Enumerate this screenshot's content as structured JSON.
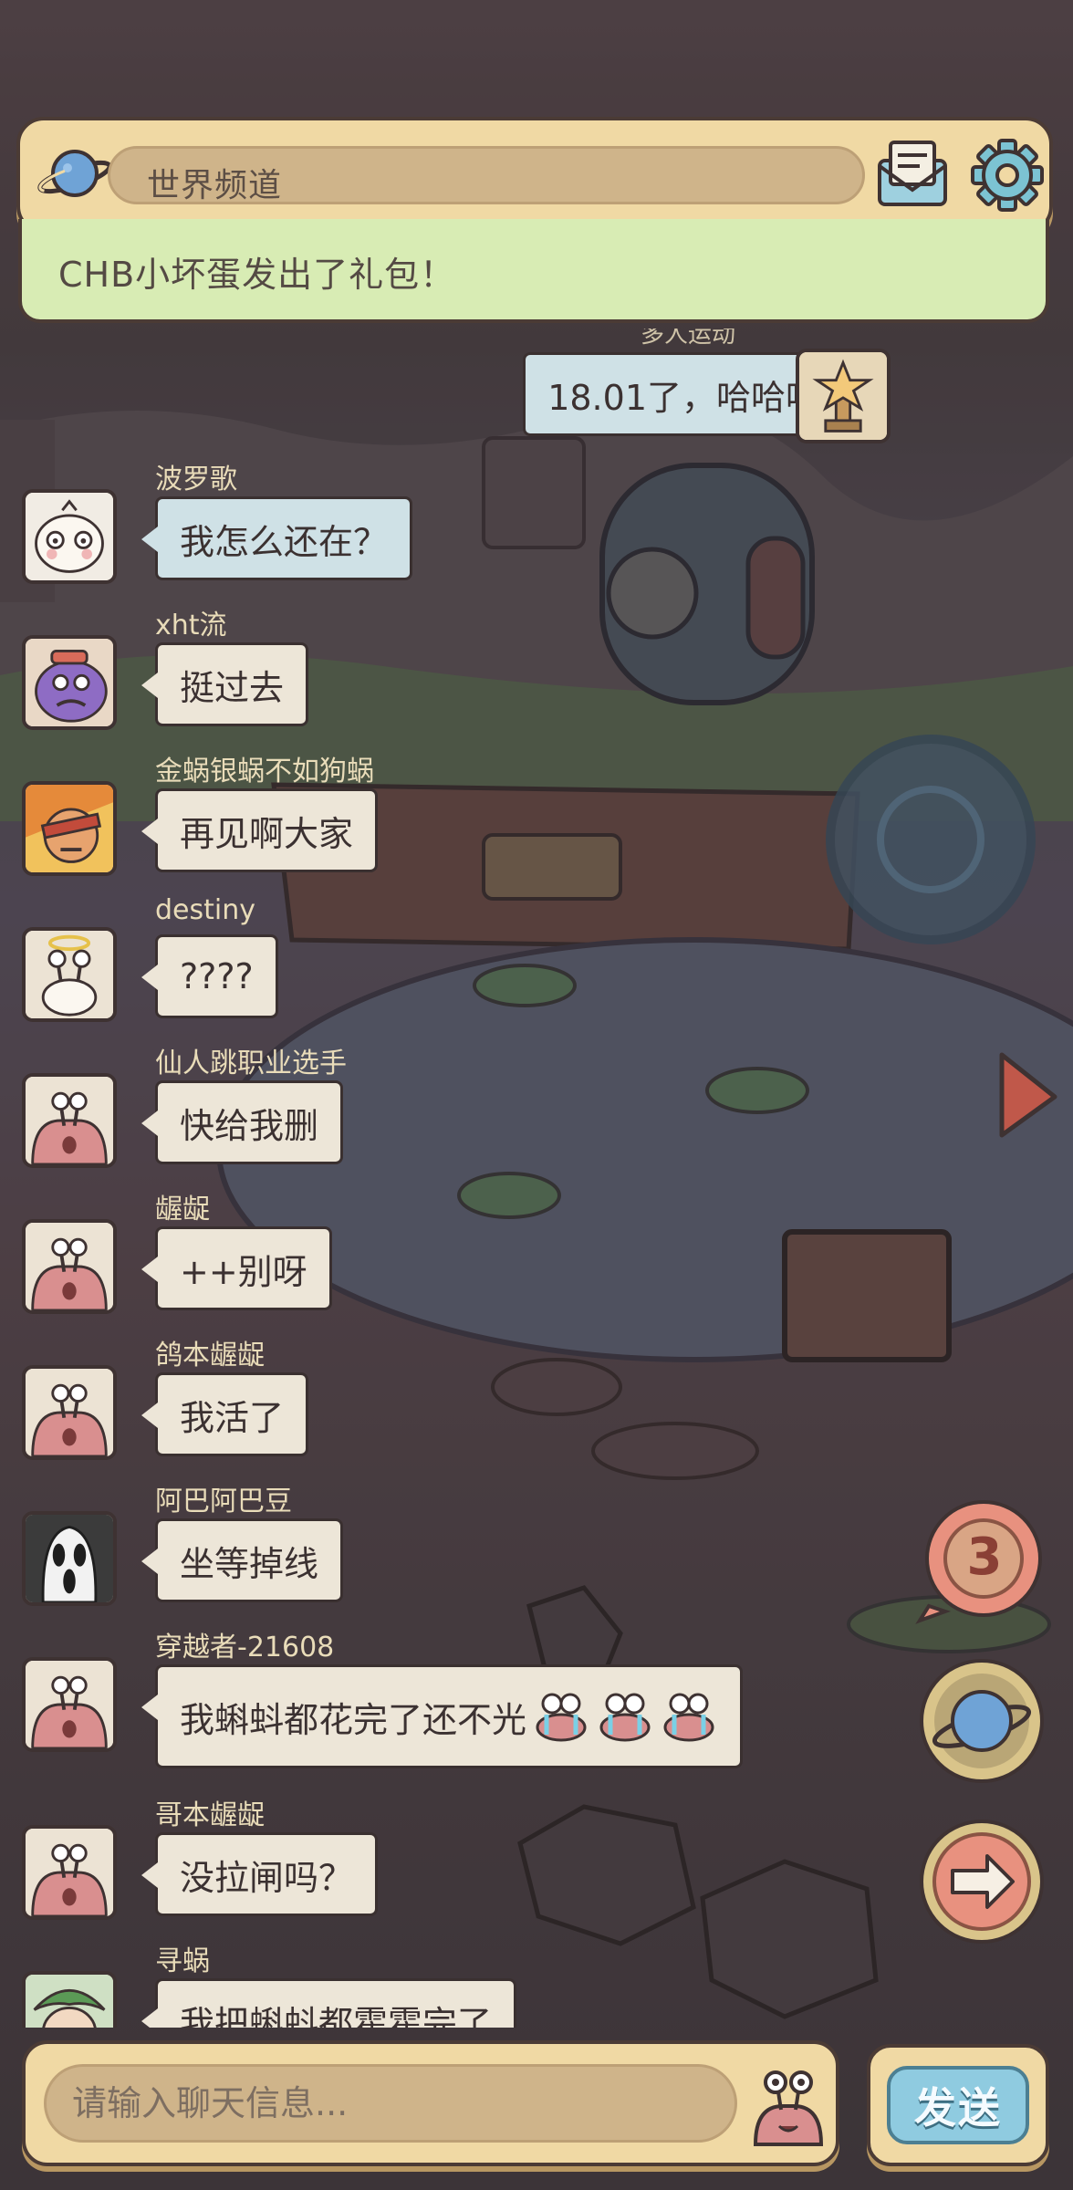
{
  "header": {
    "title": "世界频道",
    "gift_notice": "CHB小坏蛋发出了礼包！"
  },
  "self_message": {
    "name": "多人运动",
    "text": "18.01了，哈哈哈"
  },
  "messages": [
    {
      "name": "波罗歌",
      "text": "我怎么还在？"
    },
    {
      "name": "xht流",
      "text": "挺过去"
    },
    {
      "name": "金蜗银蜗不如狗蜗",
      "text": "再见啊大家"
    },
    {
      "name": "destiny",
      "text": "????"
    },
    {
      "name": "仙人跳职业选手",
      "text": "快给我删"
    },
    {
      "name": "龌龊",
      "text": "++别呀"
    },
    {
      "name": "鸽本龌龊",
      "text": "我活了"
    },
    {
      "name": "阿巴阿巴豆",
      "text": "坐等掉线"
    },
    {
      "name": "穿越者-21608",
      "text": "我蝌蚪都花完了还不光"
    },
    {
      "name": "哥本龌龊",
      "text": "没拉闸吗？"
    },
    {
      "name": "寻蜗",
      "text": "我把蝌蚪都霍霍完了"
    }
  ],
  "side_buttons": {
    "count_badge": "3"
  },
  "input": {
    "placeholder": "请输入聊天信息...",
    "send_label": "发送"
  },
  "colors": {
    "panel": "#f0d9a4",
    "notice_bg": "#d8ecb4",
    "bubble": "#ede6d8",
    "bubble_blue": "#cfe1e6",
    "send_button": "#8fcbe0",
    "name_text": "#e9dcb9"
  }
}
